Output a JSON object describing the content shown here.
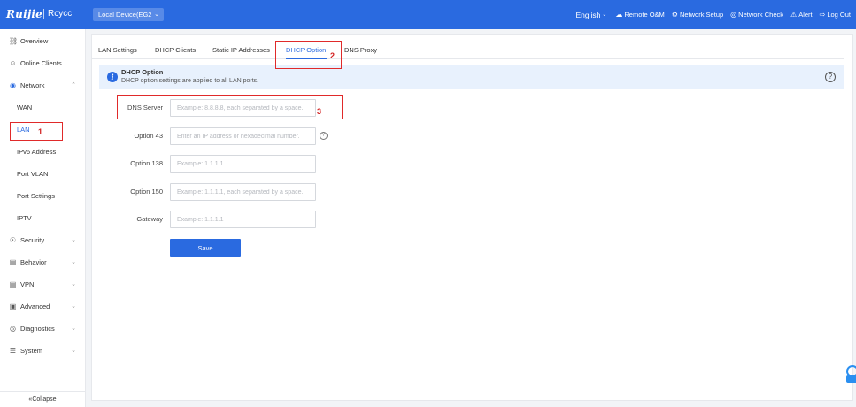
{
  "header": {
    "logo": "Ruijie",
    "logo_sub": "Rcycc",
    "device": "Local Device(EG2",
    "language": "English",
    "items": [
      {
        "label": "Remote O&M",
        "icon": "cloud-icon"
      },
      {
        "label": "Network Setup",
        "icon": "gear-icon"
      },
      {
        "label": "Network Check",
        "icon": "check-icon"
      },
      {
        "label": "Alert",
        "icon": "alert-icon"
      },
      {
        "label": "Log Out",
        "icon": "logout-icon"
      }
    ]
  },
  "sidebar": {
    "items": [
      {
        "label": "Overview",
        "icon": "overview-icon"
      },
      {
        "label": "Online Clients",
        "icon": "clients-icon"
      },
      {
        "label": "Network",
        "icon": "network-icon"
      },
      {
        "label": "WAN"
      },
      {
        "label": "LAN"
      },
      {
        "label": "IPv6 Address"
      },
      {
        "label": "Port VLAN"
      },
      {
        "label": "Port Settings"
      },
      {
        "label": "IPTV"
      },
      {
        "label": "Security",
        "icon": "security-icon"
      },
      {
        "label": "Behavior",
        "icon": "behavior-icon"
      },
      {
        "label": "VPN",
        "icon": "vpn-icon"
      },
      {
        "label": "Advanced",
        "icon": "advanced-icon"
      },
      {
        "label": "Diagnostics",
        "icon": "diagnostics-icon"
      },
      {
        "label": "System",
        "icon": "system-icon"
      }
    ],
    "collapse": "Collapse"
  },
  "tabs": [
    "LAN Settings",
    "DHCP Clients",
    "Static IP Addresses",
    "DHCP Option",
    "DNS Proxy"
  ],
  "info": {
    "title": "DHCP Option",
    "text": "DHCP option settings are applied to all LAN ports."
  },
  "form": {
    "fields": [
      {
        "label": "DNS Server",
        "placeholder": "Example: 8.8.8.8, each separated by a space.",
        "value": ""
      },
      {
        "label": "Option 43",
        "placeholder": "Enter an IP address or hexadecimal number.",
        "value": ""
      },
      {
        "label": "Option 138",
        "placeholder": "Example: 1.1.1.1",
        "value": ""
      },
      {
        "label": "Option 150",
        "placeholder": "Example: 1.1.1.1, each separated by a space.",
        "value": ""
      },
      {
        "label": "Gateway",
        "placeholder": "Example: 1.1.1.1",
        "value": ""
      }
    ],
    "save": "Save"
  },
  "annotations": [
    "1",
    "2",
    "3"
  ],
  "colors": {
    "accent": "#2a6ae0",
    "annotation": "#e02a2a",
    "info_bg": "#e8f1fd"
  }
}
